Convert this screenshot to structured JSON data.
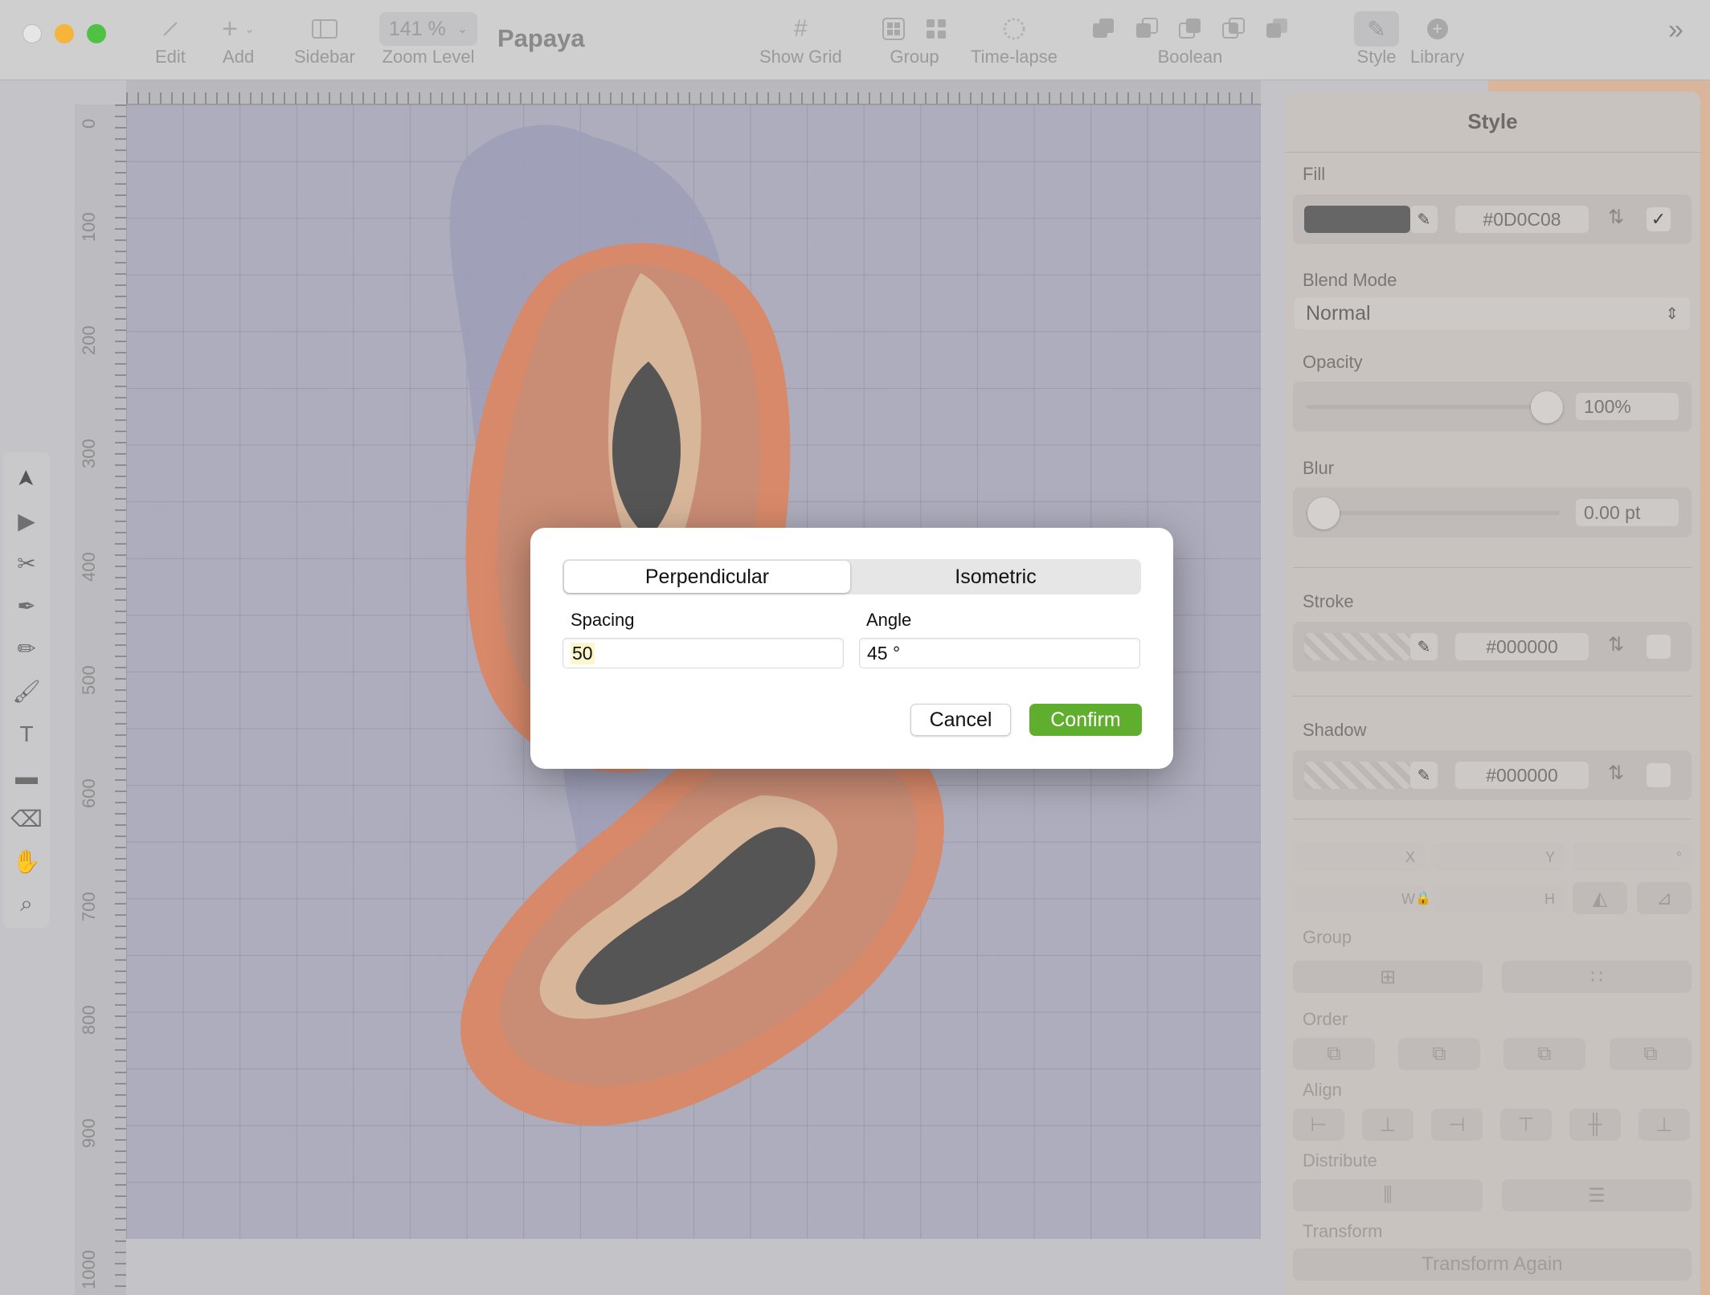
{
  "window": {
    "title": "Papaya"
  },
  "toolbar": {
    "edit": "Edit",
    "add": "Add",
    "sidebar": "Sidebar",
    "zoom_value": "141 %",
    "zoom_label": "Zoom Level",
    "show_grid": "Show Grid",
    "group": "Group",
    "timelapse": "Time-lapse",
    "boolean": "Boolean",
    "style": "Style",
    "library": "Library"
  },
  "ruler": {
    "left_ticks": [
      "0",
      "100",
      "200",
      "300",
      "400",
      "500",
      "600",
      "700",
      "800",
      "900",
      "1000"
    ]
  },
  "tools": [
    "select-arrow-icon",
    "direct-select-icon",
    "scissors-icon",
    "pen-icon",
    "pencil-icon",
    "brush-icon",
    "text-box-icon",
    "rectangle-icon",
    "eraser-icon",
    "hand-icon",
    "zoom-icon"
  ],
  "style_panel": {
    "title": "Style",
    "fill_label": "Fill",
    "fill_color": "#0D0C08",
    "fill_swatch": "#666666",
    "blend_label": "Blend Mode",
    "blend_value": "Normal",
    "opacity_label": "Opacity",
    "opacity_value": "100%",
    "opacity_level": 1.0,
    "blur_label": "Blur",
    "blur_value": "0.00 pt",
    "stroke_label": "Stroke",
    "stroke_color": "#000000",
    "shadow_label": "Shadow",
    "shadow_color": "#000000",
    "x_label": "X",
    "y_label": "Y",
    "w_label": "W",
    "h_label": "H",
    "group_label": "Group",
    "order_label": "Order",
    "align_label": "Align",
    "distribute_label": "Distribute",
    "transform_label": "Transform",
    "transform_again": "Transform Again"
  },
  "dialog": {
    "tab_perpendicular": "Perpendicular",
    "tab_isometric": "Isometric",
    "spacing_label": "Spacing",
    "spacing_value": "50",
    "angle_label": "Angle",
    "angle_value": "45 °",
    "cancel": "Cancel",
    "confirm": "Confirm"
  },
  "colors": {
    "confirm_button": "#5fae2e",
    "canvas": "#adadbd",
    "papaya_skin": "#d8896a",
    "papaya_flesh": "#c98c74",
    "seeds": "#555555"
  }
}
